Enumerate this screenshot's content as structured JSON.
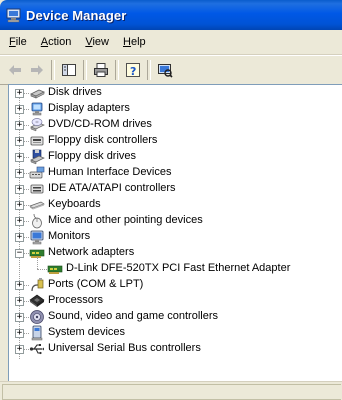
{
  "window": {
    "title": "Device Manager"
  },
  "menu": [
    {
      "label": "File",
      "mnemonic": "F",
      "rest": "ile"
    },
    {
      "label": "Action",
      "mnemonic": "A",
      "rest": "ction"
    },
    {
      "label": "View",
      "mnemonic": "V",
      "rest": "iew"
    },
    {
      "label": "Help",
      "mnemonic": "H",
      "rest": "elp"
    }
  ],
  "tree": {
    "items": [
      {
        "label": "Disk drives",
        "icon": "disk-drive-icon",
        "expanded": false
      },
      {
        "label": "Display adapters",
        "icon": "display-adapter-icon",
        "expanded": false
      },
      {
        "label": "DVD/CD-ROM drives",
        "icon": "cdrom-drive-icon",
        "expanded": false
      },
      {
        "label": "Floppy disk controllers",
        "icon": "floppy-controller-icon",
        "expanded": false
      },
      {
        "label": "Floppy disk drives",
        "icon": "floppy-drive-icon",
        "expanded": false
      },
      {
        "label": "Human Interface Devices",
        "icon": "hid-icon",
        "expanded": false
      },
      {
        "label": "IDE ATA/ATAPI controllers",
        "icon": "ide-controller-icon",
        "expanded": false
      },
      {
        "label": "Keyboards",
        "icon": "keyboard-icon",
        "expanded": false
      },
      {
        "label": "Mice and other pointing devices",
        "icon": "mouse-icon",
        "expanded": false
      },
      {
        "label": "Monitors",
        "icon": "monitor-icon",
        "expanded": false
      },
      {
        "label": "Network adapters",
        "icon": "network-adapter-icon",
        "expanded": true,
        "children": [
          {
            "label": "D-Link DFE-520TX PCI Fast Ethernet Adapter",
            "icon": "network-card-icon"
          }
        ]
      },
      {
        "label": "Ports (COM & LPT)",
        "icon": "port-icon",
        "expanded": false
      },
      {
        "label": "Processors",
        "icon": "processor-icon",
        "expanded": false
      },
      {
        "label": "Sound, video and game controllers",
        "icon": "sound-icon",
        "expanded": false
      },
      {
        "label": "System devices",
        "icon": "system-device-icon",
        "expanded": false
      },
      {
        "label": "Universal Serial Bus controllers",
        "icon": "usb-icon",
        "expanded": false
      }
    ]
  },
  "colors": {
    "titlebar": "#0054e3",
    "title_text": "#ffffff",
    "chrome": "#ece9d8",
    "tree_bg": "#ffffff"
  }
}
